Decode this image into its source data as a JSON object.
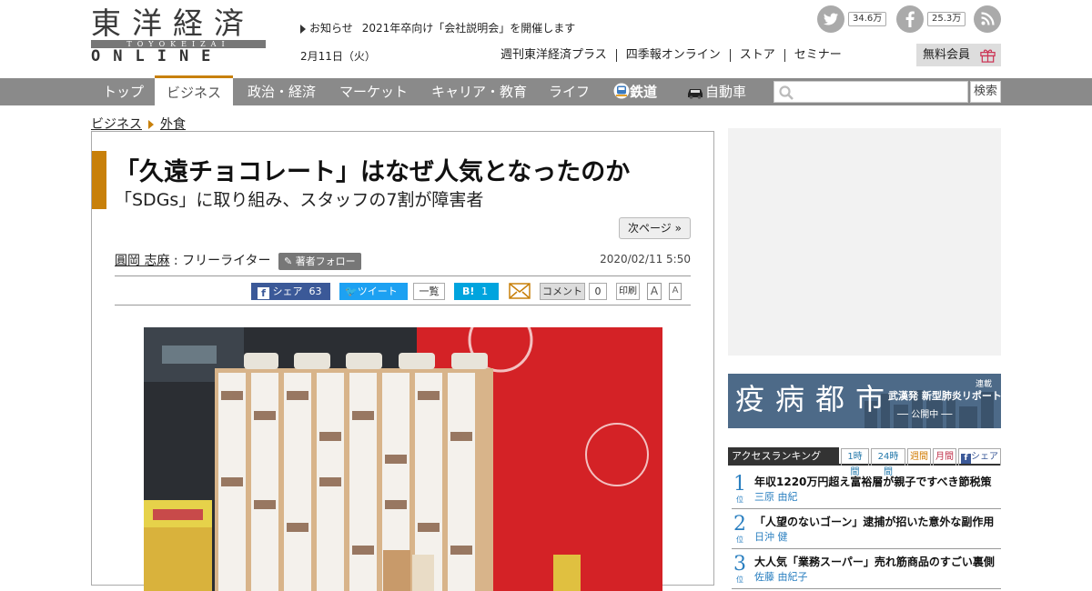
{
  "header": {
    "logo_jp": "東洋経済",
    "logo_sub": "TOYOKEIZAI",
    "logo_en": "ONLINE",
    "news_label": "お知らせ",
    "news_text": "2021年卒向け「会社説明会」を開催します",
    "date": "2月11日（火）",
    "links": [
      "週刊東洋経済プラス",
      "四季報オンライン",
      "ストア",
      "セミナー"
    ],
    "member_label": "無料会員",
    "twitter_count": "34.6万",
    "facebook_count": "25.3万",
    "colors": {
      "accent": "#c8800a",
      "nav": "#8a8a8a"
    }
  },
  "nav": {
    "items": [
      "トップ",
      "ビジネス",
      "政治・経済",
      "マーケット",
      "キャリア・教育",
      "ライフ",
      "鉄道",
      "自動車"
    ],
    "active": "ビジネス",
    "search_button": "検索"
  },
  "breadcrumb": [
    "ビジネス",
    "外食"
  ],
  "article": {
    "title": "「久遠チョコレート」はなぜ人気となったのか",
    "subtitle": "「SDGs」に取り組み、スタッフの7割が障害者",
    "next_page": "次ページ »",
    "author_name": "圓岡 志麻",
    "author_role": ": フリーライター",
    "follow_label": "著者フォロー",
    "pub_date": "2020/02/11 5:50",
    "share": {
      "fb_label": "シェア",
      "fb_count": "63",
      "tw_label": "ツイート",
      "list_label": "一覧",
      "hatena_label": "B!",
      "hatena_count": "1",
      "comment_label": "コメント",
      "comment_count": "0",
      "print_label": "印刷",
      "font_large": "A",
      "font_small": "A"
    }
  },
  "banner": {
    "big": "疫病都市",
    "small": "武漢発 新型肺炎リポート",
    "small2": "── 公開中 ──",
    "tag": "連載"
  },
  "ranking": {
    "title": "アクセスランキング",
    "tabs": [
      "1時間",
      "24時間",
      "週間",
      "月間",
      "シェア"
    ],
    "items": [
      {
        "rank": "1",
        "unit": "位",
        "title": "年収1220万円超え富裕層が親子ですべき節税策",
        "author": "三原 由紀"
      },
      {
        "rank": "2",
        "unit": "位",
        "title": "「人望のないゴーン」逮捕が招いた意外な副作用",
        "author": "日沖 健"
      },
      {
        "rank": "3",
        "unit": "位",
        "title": "大人気「業務スーパー」売れ筋商品のすごい裏側",
        "author": "佐藤 由紀子"
      }
    ]
  }
}
